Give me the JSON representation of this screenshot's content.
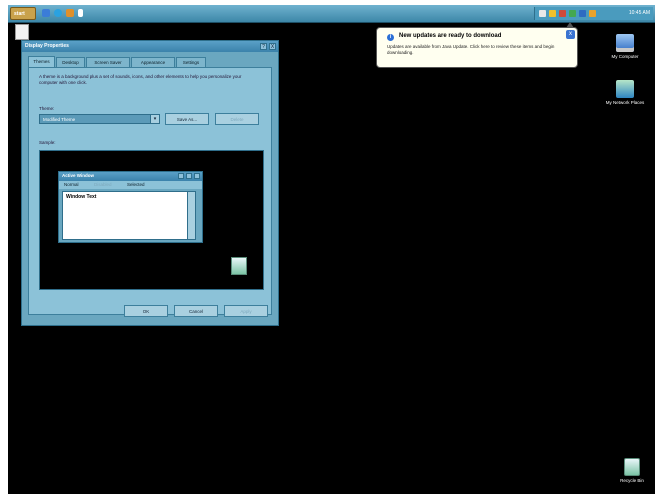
{
  "taskbar": {
    "start_label": "start",
    "clock": "10:45 AM"
  },
  "balloon": {
    "title": "New updates are ready to download",
    "body": "Updates are available from Java Update. Click here to review these items and begin downloading.",
    "info_icon_glyph": "i",
    "close_glyph": "x"
  },
  "desktop_icons": [
    {
      "label": "My Computer",
      "icon": "computer-icon"
    },
    {
      "label": "My Network Places",
      "icon": "network-places-icon"
    },
    {
      "label": "Recycle Bin",
      "icon": "recycle-bin-icon"
    }
  ],
  "dialog": {
    "title": "Display Properties",
    "title_buttons": [
      "?",
      "X"
    ],
    "tabs": [
      "Themes",
      "Desktop",
      "Screen Saver",
      "Appearance",
      "Settings"
    ],
    "active_tab": "Themes",
    "description": "A theme is a background plus a set of sounds, icons, and other elements to help you personalize your computer with one click.",
    "theme_label": "Theme:",
    "theme_value": "Modified Theme",
    "save_as_label": "Save As...",
    "delete_label": "Delete",
    "sample_label": "Sample:",
    "sample": {
      "window_title": "Active Window",
      "menu_items": [
        "Normal",
        "Disabled",
        "Selected"
      ],
      "window_text": "Window Text"
    },
    "ok_label": "OK",
    "cancel_label": "Cancel",
    "apply_label": "Apply"
  },
  "colors": {
    "desktop": "#000000",
    "taskbar": "#4a9bbe",
    "dialog": "#6aa7c0",
    "balloon": "#fffff0"
  }
}
